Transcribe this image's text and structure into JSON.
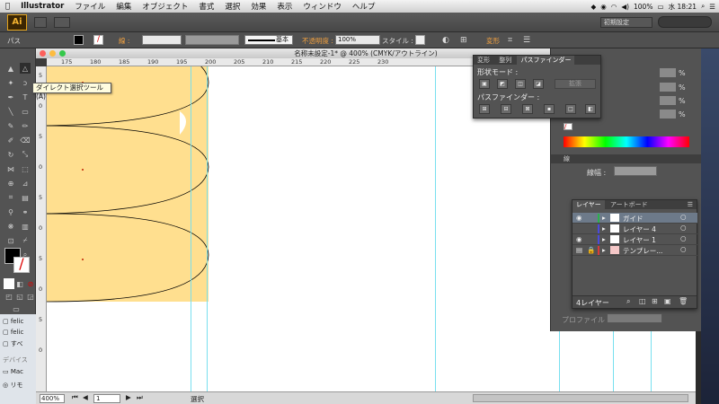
{
  "menubar": {
    "app_name": "Illustrator",
    "items": [
      "ファイル",
      "編集",
      "オブジェクト",
      "書式",
      "選択",
      "効果",
      "表示",
      "ウィンドウ",
      "ヘルプ"
    ],
    "battery": "100%",
    "clock": "水 18:21"
  },
  "appbar": {
    "logo": "Ai",
    "workspace": "初期設定"
  },
  "control": {
    "selection_type": "パス",
    "stroke_label": "線 :",
    "brush_label": "基本",
    "opacity_label": "不透明度 :",
    "opacity_value": "100%",
    "style_label": "スタイル :",
    "transform_label": "変形"
  },
  "tooltip": "ダイレクト選択ツール (A)",
  "document": {
    "title": "名称未設定-1* @ 400% (CMYK/アウトライン)",
    "ruler_h": [
      "175",
      "180",
      "185",
      "190",
      "195",
      "200",
      "205",
      "210",
      "215",
      "220",
      "225",
      "230"
    ],
    "ruler_v": [
      "5",
      "0",
      "5",
      "0",
      "5",
      "0",
      "5",
      "0",
      "5",
      "0"
    ],
    "zoom": "400%",
    "page": "1",
    "status": "選択"
  },
  "pathfinder": {
    "tabs": [
      "変形",
      "整列",
      "パスファインダー"
    ],
    "shape_modes_label": "形状モード :",
    "expand_button": "拡張",
    "pathfinders_label": "パスファインダー :"
  },
  "right_panel": {
    "percent": [
      "%",
      "%",
      "%",
      "%"
    ],
    "stroke_header": "線",
    "weight_label": "線幅 :",
    "profile_label": "プロファイル :"
  },
  "layers": {
    "tabs": [
      "レイヤー",
      "アートボード"
    ],
    "rows": [
      {
        "name": "ガイド",
        "color": "#2bb24c"
      },
      {
        "name": "レイヤー 4",
        "color": "#4a4adb"
      },
      {
        "name": "レイヤー 1",
        "color": "#4a4adb"
      },
      {
        "name": "テンプレー...",
        "color": "#d83a3a"
      }
    ],
    "count": "4レイヤー"
  },
  "finder": {
    "items": [
      "felic",
      "felic",
      "すべ"
    ],
    "devices_label": "デバイス",
    "device_items": [
      "Mac",
      "リモ"
    ]
  },
  "colors": {
    "shape_fill": "#ffdf8f",
    "guide": "#78e0ef",
    "accent": "#e2a21a"
  }
}
